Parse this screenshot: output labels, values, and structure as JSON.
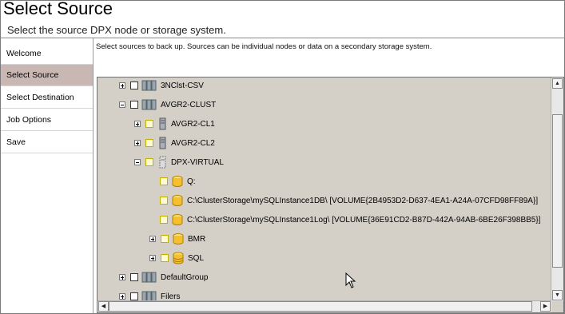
{
  "header": {
    "title": "Select Source",
    "subtitle": "Select the source DPX node or storage system."
  },
  "nav": {
    "items": [
      {
        "label": "Welcome",
        "active": false
      },
      {
        "label": "Select Source",
        "active": true
      },
      {
        "label": "Select Destination",
        "active": false
      },
      {
        "label": "Job Options",
        "active": false
      },
      {
        "label": "Save",
        "active": false
      }
    ]
  },
  "main": {
    "instruction": "Select sources to back up. Sources can be individual nodes or data on a secondary storage system."
  },
  "tree": {
    "nodes": [
      {
        "label": "3NClst-CSV",
        "icon": "cluster-icon",
        "expander": "plus"
      },
      {
        "label": "AVGR2-CLUST",
        "icon": "cluster-icon",
        "expander": "minus"
      },
      {
        "label": "AVGR2-CL1",
        "icon": "server-icon",
        "expander": "plus"
      },
      {
        "label": "AVGR2-CL2",
        "icon": "server-icon",
        "expander": "plus"
      },
      {
        "label": "DPX-VIRTUAL",
        "icon": "virtual-server-icon",
        "expander": "minus"
      },
      {
        "label": "Q:",
        "icon": "volume-icon",
        "expander": "none"
      },
      {
        "label": "C:\\ClusterStorage\\mySQLInstance1DB\\ [VOLUME{2B4953D2-D637-4EA1-A24A-07CFD98FF89A}]",
        "icon": "volume-icon",
        "expander": "none"
      },
      {
        "label": "C:\\ClusterStorage\\mySQLInstance1Log\\ [VOLUME{36E91CD2-B87D-442A-94AB-6BE26F398BB5}]",
        "icon": "volume-icon",
        "expander": "none"
      },
      {
        "label": "BMR",
        "icon": "volume-icon",
        "expander": "plus"
      },
      {
        "label": "SQL",
        "icon": "database-icon",
        "expander": "plus"
      },
      {
        "label": "DefaultGroup",
        "icon": "cluster-icon",
        "expander": "plus"
      },
      {
        "label": "Filers",
        "icon": "cluster-icon",
        "expander": "plus"
      }
    ]
  },
  "colors": {
    "nav_active": "#c9b7b4",
    "tree_background": "#d4d0c8"
  }
}
